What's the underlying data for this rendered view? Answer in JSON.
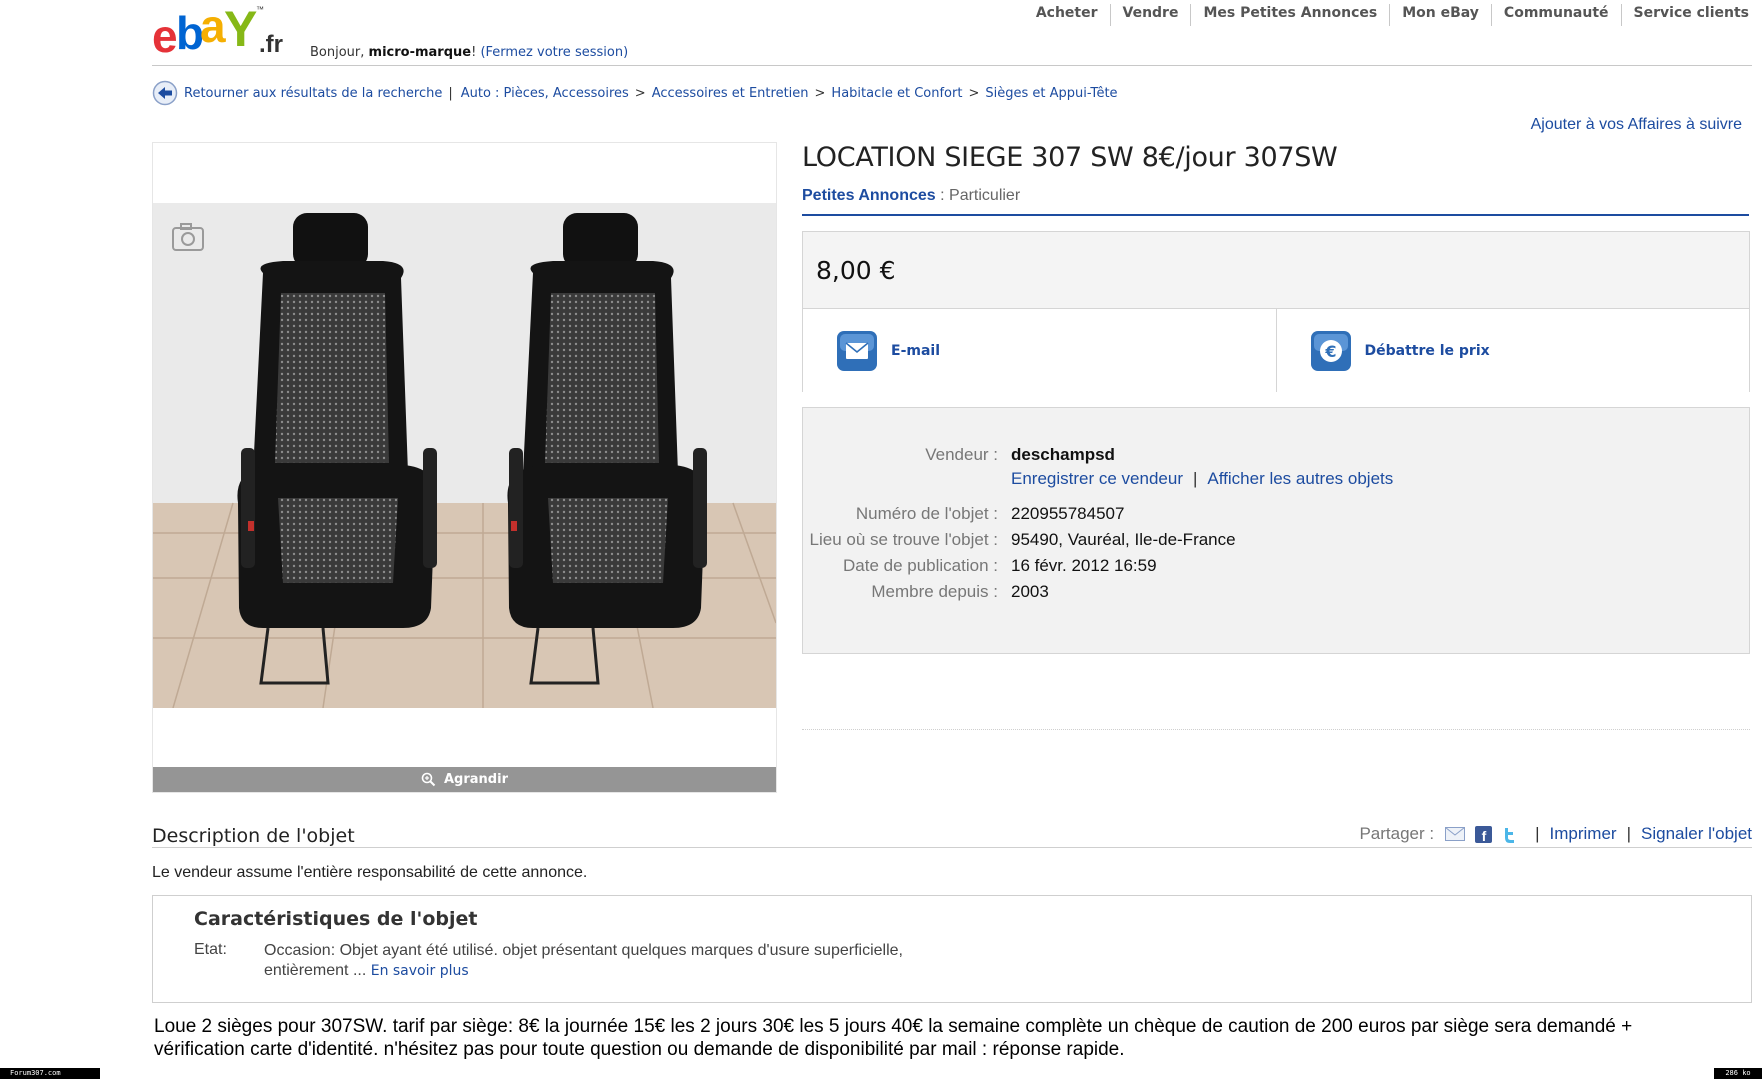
{
  "brand": {
    "logo_letters": [
      "e",
      "b",
      "a",
      "Y"
    ],
    "logo_suffix": ".fr",
    "logo_tm": "™",
    "logo_colors": [
      "#e53238",
      "#0064d2",
      "#f5af02",
      "#86b817"
    ]
  },
  "header": {
    "greeting_prefix": "Bonjour, ",
    "username": "micro-marque",
    "greeting_suffix": "! ",
    "logout_link": "(Fermez votre session)",
    "nav": [
      "Acheter",
      "Vendre",
      "Mes Petites Annonces",
      "Mon eBay",
      "Communauté",
      "Service clients"
    ]
  },
  "breadcrumb": {
    "back_link": "Retourner aux résultats de la recherche",
    "separator": "|",
    "arrow": ">",
    "items": [
      "Auto : Pièces, Accessoires",
      "Accessoires et Entretien",
      "Habitacle et Confort",
      "Sièges et Appui-Tête"
    ]
  },
  "follow_link": "Ajouter à vos Affaires à suivre",
  "listing": {
    "title": "LOCATION SIEGE 307 SW 8€/jour 307SW",
    "type_label": "Petites Annonces",
    "type_sep": " : ",
    "seller_type": "Particulier",
    "price": "8,00 €",
    "enlarge_label": "Agrandir",
    "actions": [
      {
        "label": "E-mail",
        "icon": "envelope-icon"
      },
      {
        "label": "Débattre le prix",
        "icon": "euro-icon"
      }
    ]
  },
  "seller": {
    "seller_label": "Vendeur :",
    "seller_name": "deschampsd",
    "save_seller": "Enregistrer ce vendeur",
    "link_sep": "|",
    "other_items": "Afficher les autres objets",
    "item_number_label": "Numéro de l'objet :",
    "item_number": "220955784507",
    "location_label": "Lieu où se trouve l'objet :",
    "location": "95490, Vauréal, Ile-de-France",
    "date_label": "Date de publication :",
    "date": "16 févr. 2012 16:59",
    "member_label": "Membre depuis :",
    "member_since": "2003"
  },
  "description": {
    "title": "Description de l'objet",
    "share_label": "Partager :",
    "pipe": "|",
    "print_link": "Imprimer",
    "report_link": "Signaler l'objet",
    "disclaimer": "Le vendeur assume l'entière responsabilité de cette annonce.",
    "charac_title": "Caractéristiques de l'objet",
    "etat_label": "Etat:",
    "etat_value": "Occasion: Objet ayant été utilisé. objet présentant quelques marques d'usure superficielle, entièrement ... ",
    "read_more": "En savoir plus",
    "body": "Loue 2 sièges pour 307SW. tarif par siège: 8€ la journée 15€ les 2 jours 30€ les 5 jours 40€ la semaine complète un chèque de caution de 200 euros par siège sera demandé + vérification carte d'identité. n'hésitez pas pour toute question ou demande de disponibilité par mail : réponse rapide."
  },
  "watermark": {
    "left": "Forum307.com",
    "right": "286 ko"
  }
}
